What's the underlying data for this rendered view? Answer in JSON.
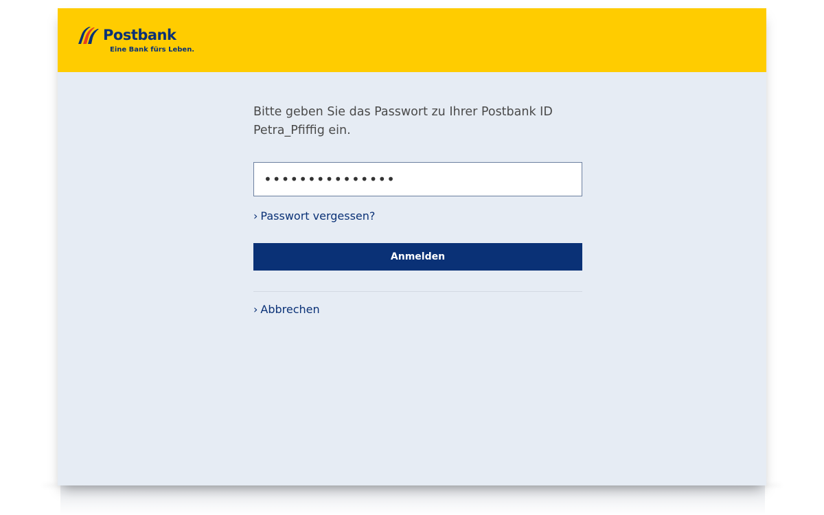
{
  "brand": {
    "name": "Postbank",
    "claim": "Eine Bank fürs Leben.",
    "header_color": "#ffcc00",
    "primary_color": "#0a3176",
    "logo_icon": "postbank-stripes-logo"
  },
  "login": {
    "prompt": "Bitte geben Sie das Passwort zu Ihrer Postbank ID Petra_Pfiffig ein.",
    "password_value": "•••••••••••••••",
    "forgot_link": "Passwort vergessen?",
    "submit_label": "Anmelden",
    "cancel_link": "Abbrechen",
    "link_chevron": "›"
  }
}
